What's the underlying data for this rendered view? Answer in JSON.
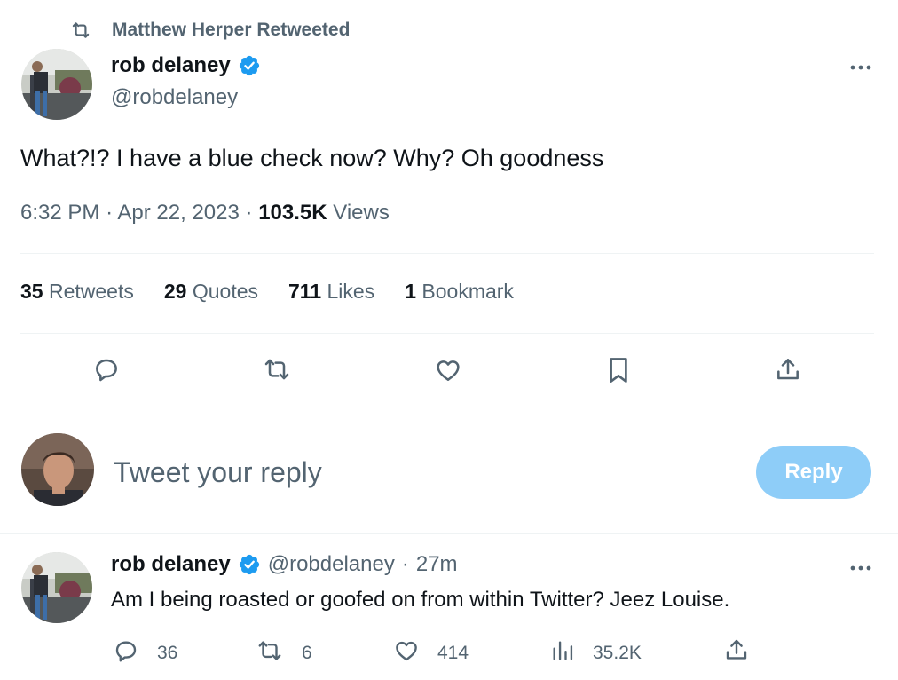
{
  "retweet_header": {
    "label": "Matthew Herper Retweeted",
    "icon": "retweet-icon"
  },
  "tweet": {
    "author_name": "rob delaney",
    "handle": "@robdelaney",
    "verified": true,
    "text": "What?!? I have a blue check now? Why? Oh goodness",
    "time": "6:32 PM",
    "date": "Apr 22, 2023",
    "views_count": "103.5K",
    "views_label": "Views",
    "stats": [
      {
        "count": "35",
        "label": "Retweets"
      },
      {
        "count": "29",
        "label": "Quotes"
      },
      {
        "count": "711",
        "label": "Likes"
      },
      {
        "count": "1",
        "label": "Bookmark"
      }
    ],
    "actions": [
      "reply-icon",
      "retweet-icon",
      "like-icon",
      "bookmark-icon",
      "share-icon"
    ]
  },
  "composer": {
    "placeholder": "Tweet your reply",
    "button_label": "Reply"
  },
  "reply": {
    "author_name": "rob delaney",
    "handle": "@robdelaney",
    "separator": "·",
    "time": "27m",
    "text": "Am I being roasted or goofed on from within Twitter? Jeez Louise.",
    "counts": {
      "replies": "36",
      "retweets": "6",
      "likes": "414",
      "views": "35.2K"
    }
  },
  "colors": {
    "accent": "#1d9bf0",
    "muted": "#536471",
    "text": "#0f1419",
    "reply_button": "#8ecdf8"
  }
}
